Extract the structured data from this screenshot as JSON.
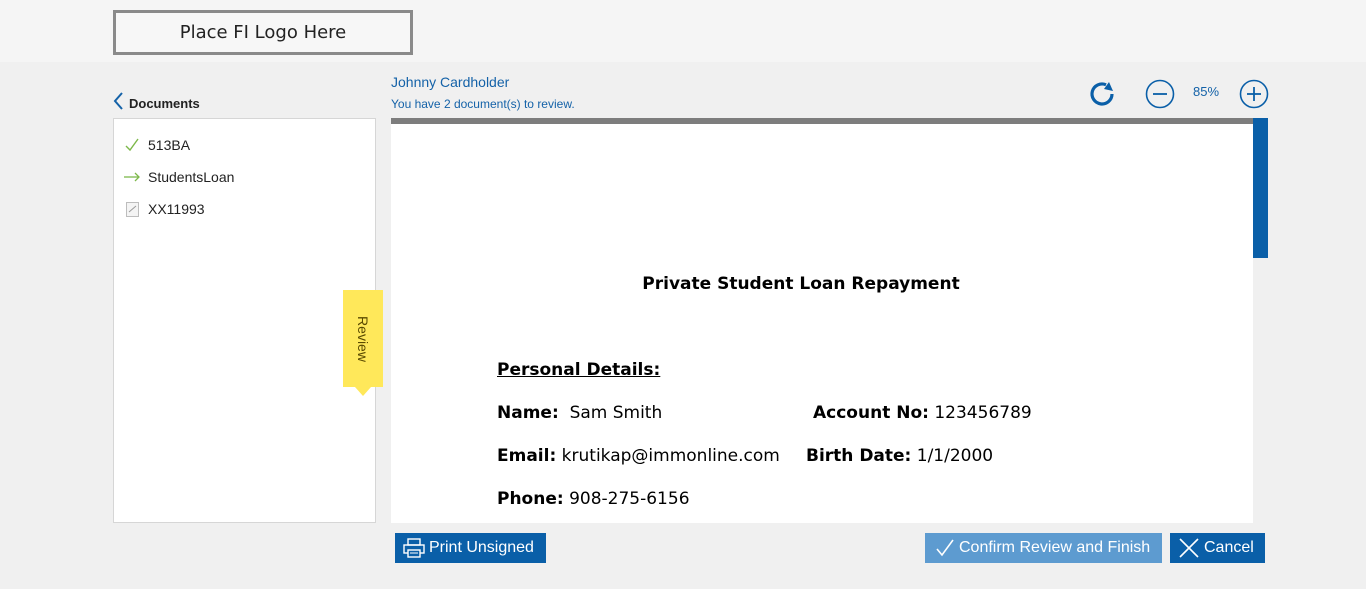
{
  "header": {
    "logo_text": "Place FI Logo Here"
  },
  "sidebar": {
    "title": "Documents",
    "items": [
      {
        "name": "513BA",
        "status": "reviewed",
        "icon": "check-icon"
      },
      {
        "name": "StudentsLoan",
        "status": "current",
        "icon": "arrow-right-icon"
      },
      {
        "name": "XX11993",
        "status": "pending",
        "icon": "document-icon"
      }
    ],
    "review_tab": "Review"
  },
  "viewer": {
    "user": "Johnny Cardholder",
    "message": "You have 2 document(s) to review.",
    "zoom": "85%"
  },
  "document": {
    "title": "Private Student Loan Repayment",
    "section": "Personal Details:",
    "fields": {
      "name_label": "Name:",
      "name_value": "Sam Smith",
      "account_label": "Account No:",
      "account_value": "123456789",
      "email_label": "Email:",
      "email_value": "krutikap@immonline.com",
      "birth_label": "Birth Date:",
      "birth_value": "1/1/2000",
      "phone_label": "Phone:",
      "phone_value": "908-275-6156"
    }
  },
  "actions": {
    "print": "Print Unsigned",
    "confirm": "Confirm Review and Finish",
    "cancel": "Cancel"
  },
  "colors": {
    "primary": "#0a5fa8",
    "confirm": "#5d9bd0",
    "text_link": "#1462a8",
    "review_tab": "#ffe85a"
  }
}
